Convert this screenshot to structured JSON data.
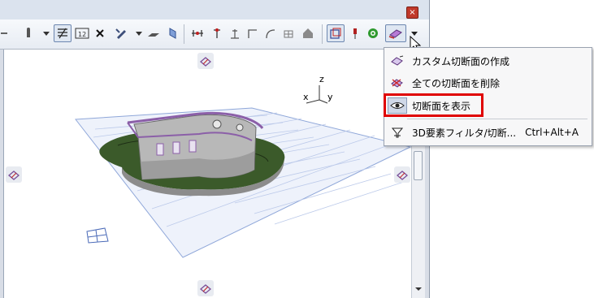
{
  "window": {
    "close_glyph": "×"
  },
  "toolbar": {
    "buttons": [
      {
        "name": "arrow-icon"
      },
      {
        "name": "marquee-icon"
      },
      {
        "name": "section-view-icon"
      },
      {
        "name": "scale-icon"
      },
      {
        "name": "cross-icon"
      },
      {
        "name": "pen-icon"
      },
      {
        "name": "eraser-icon"
      },
      {
        "name": "plane-icon"
      },
      {
        "name": "dimension-icon"
      },
      {
        "name": "level-icon"
      },
      {
        "name": "elevation-icon"
      },
      {
        "name": "corner-icon"
      },
      {
        "name": "curve-icon"
      },
      {
        "name": "grid-tool-icon"
      },
      {
        "name": "house-icon"
      },
      {
        "name": "frame-select-icon"
      },
      {
        "name": "pin-icon"
      },
      {
        "name": "target-icon"
      },
      {
        "name": "cutaway-icon"
      },
      {
        "name": "dropdown-arrow-icon"
      }
    ]
  },
  "axes": {
    "z": "z",
    "x": "x",
    "y": "y"
  },
  "menu": {
    "items": [
      {
        "label": "カスタム切断面の作成",
        "shortcut": ""
      },
      {
        "label": "全ての切断面を削除",
        "shortcut": ""
      },
      {
        "label": "切断面を表示",
        "shortcut": ""
      },
      {
        "label": "3D要素フィルタ/切断...",
        "shortcut": "Ctrl+Alt+A"
      }
    ]
  },
  "colors": {
    "highlight": "#e00000",
    "ground": "#3b5a2a",
    "grid": "#8fa7d9",
    "wall": "#b0b0b0",
    "accent_purple": "#8b5fa8"
  }
}
